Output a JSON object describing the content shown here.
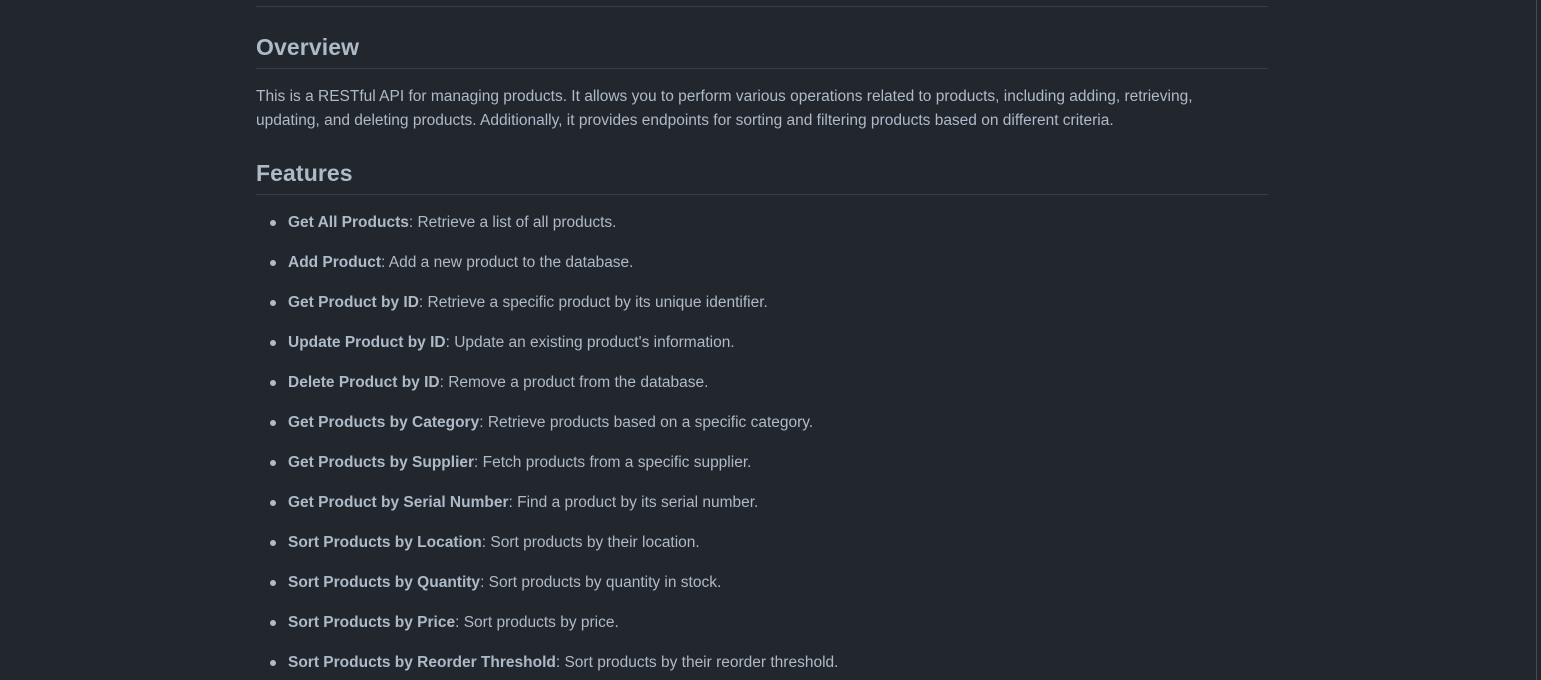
{
  "readme": {
    "overview": {
      "heading": "Overview",
      "text": "This is a RESTful API for managing products. It allows you to perform various operations related to products, including adding, retrieving, updating, and deleting products. Additionally, it provides endpoints for sorting and filtering products based on different criteria."
    },
    "features": {
      "heading": "Features",
      "items": [
        {
          "name": "Get All Products",
          "description": ": Retrieve a list of all products."
        },
        {
          "name": "Add Product",
          "description": ": Add a new product to the database."
        },
        {
          "name": "Get Product by ID",
          "description": ": Retrieve a specific product by its unique identifier."
        },
        {
          "name": "Update Product by ID",
          "description": ": Update an existing product's information."
        },
        {
          "name": "Delete Product by ID",
          "description": ": Remove a product from the database."
        },
        {
          "name": "Get Products by Category",
          "description": ": Retrieve products based on a specific category."
        },
        {
          "name": "Get Products by Supplier",
          "description": ": Fetch products from a specific supplier."
        },
        {
          "name": "Get Product by Serial Number",
          "description": ": Find a product by its serial number."
        },
        {
          "name": "Sort Products by Location",
          "description": ": Sort products by their location."
        },
        {
          "name": "Sort Products by Quantity",
          "description": ": Sort products by quantity in stock."
        },
        {
          "name": "Sort Products by Price",
          "description": ": Sort products by price."
        },
        {
          "name": "Sort Products by Reorder Threshold",
          "description": ": Sort products by their reorder threshold."
        }
      ]
    }
  },
  "colors": {
    "background": "#22272e",
    "text": "#adbac7",
    "divider": "#373e47"
  }
}
